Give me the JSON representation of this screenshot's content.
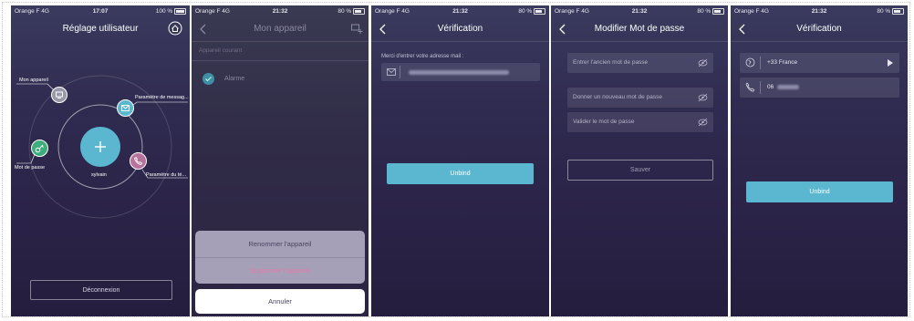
{
  "status_bars": [
    {
      "carrier": "Orange F  4G",
      "time": "17:07",
      "right": "100 %"
    },
    {
      "carrier": "Orange F  4G",
      "time": "21:32",
      "right": "80 %"
    },
    {
      "carrier": "Orange F  4G",
      "time": "21:32",
      "right": "80 %"
    },
    {
      "carrier": "Orange F  4G",
      "time": "21:32",
      "right": "80 %"
    },
    {
      "carrier": "Orange F  4G",
      "time": "21:32",
      "right": "80 %"
    }
  ],
  "screen1": {
    "title": "Réglage utilisateur",
    "labels": {
      "device": "Mon appareil",
      "message": "Paramètre de messag...",
      "password": "Mot de passe",
      "phone": "Paramètre du té...",
      "user": "sylvain"
    },
    "logout": "Déconnexion"
  },
  "screen2": {
    "title": "Mon appareil",
    "section": "Appareil courant",
    "device": "Alarme",
    "sheet": {
      "rename": "Renommer l'appareil",
      "delete": "Supprimer l'appareil",
      "cancel": "Annuler"
    }
  },
  "screen3": {
    "title": "Vérification",
    "prompt": "Merci d'entrer votre adresse mail :",
    "button": "Unbind"
  },
  "screen4": {
    "title": "Modifier Mot de passe",
    "old_placeholder": "Entrer l'ancien mot de passe",
    "new_placeholder": "Donner un nouveau mot de passe",
    "confirm_placeholder": "Valider le mot de passe",
    "save": "Sauver"
  },
  "screen5": {
    "title": "Vérification",
    "country": "+33 France",
    "phone_prefix": "06",
    "button": "Unbind"
  },
  "colors": {
    "accent": "#5bb6cf",
    "danger": "#e87aa8",
    "green": "#3fae7c",
    "pink": "#b7729e"
  }
}
